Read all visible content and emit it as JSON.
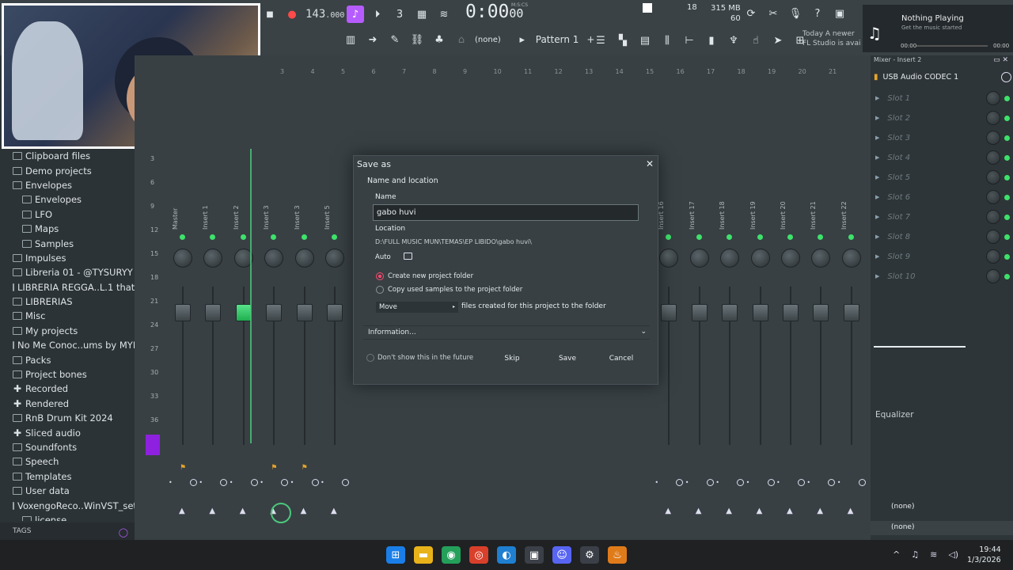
{
  "toolbar": {
    "tempo": "143",
    "tempo_frac": ".000",
    "time": "0:00",
    "time_small": "00",
    "time_label": "M:S:CS",
    "cpu": "18",
    "mem": "315 MB",
    "poly": "60",
    "pattern": "Pattern 1",
    "none_label": "(none)",
    "news_line1": "Today  A newer",
    "news_line2": "FL Studio is avai"
  },
  "media": {
    "title": "Nothing Playing",
    "subtitle": "Get the music started",
    "time_start": "00:00",
    "time_end": "00:00"
  },
  "browser": {
    "items": [
      {
        "label": "Clipboard files",
        "level": 0,
        "icon": "folder-icon"
      },
      {
        "label": "Demo projects",
        "level": 0,
        "icon": "folder-icon"
      },
      {
        "label": "Envelopes",
        "level": 0,
        "icon": "folder-icon"
      },
      {
        "label": "Envelopes",
        "level": 1,
        "icon": "folder-icon"
      },
      {
        "label": "LFO",
        "level": 1,
        "icon": "folder-icon"
      },
      {
        "label": "Maps",
        "level": 1,
        "icon": "folder-icon"
      },
      {
        "label": "Samples",
        "level": 1,
        "icon": "folder-icon"
      },
      {
        "label": "Impulses",
        "level": 0,
        "icon": "folder-icon"
      },
      {
        "label": "Libreria 01 - @TYSURYY",
        "level": 0,
        "icon": "folder-icon"
      },
      {
        "label": "LIBRERIA REGGA..L.1 thatboy r",
        "level": 0,
        "icon": "folder-icon"
      },
      {
        "label": "LIBRERIAS",
        "level": 0,
        "icon": "folder-icon"
      },
      {
        "label": "Misc",
        "level": 0,
        "icon": "folder-icon"
      },
      {
        "label": "My projects",
        "level": 0,
        "icon": "folder-icon"
      },
      {
        "label": "No Me Conoc..ums by MYMBA",
        "level": 0,
        "icon": "folder-icon"
      },
      {
        "label": "Packs",
        "level": 0,
        "icon": "folder-icon"
      },
      {
        "label": "Project bones",
        "level": 0,
        "icon": "folder-icon"
      },
      {
        "label": "Recorded",
        "level": 0,
        "icon": "plus-icon"
      },
      {
        "label": "Rendered",
        "level": 0,
        "icon": "plus-icon"
      },
      {
        "label": "RnB Drum Kit 2024",
        "level": 0,
        "icon": "folder-icon"
      },
      {
        "label": "Sliced audio",
        "level": 0,
        "icon": "plus-icon"
      },
      {
        "label": "Soundfonts",
        "level": 0,
        "icon": "folder-icon"
      },
      {
        "label": "Speech",
        "level": 0,
        "icon": "folder-icon"
      },
      {
        "label": "Templates",
        "level": 0,
        "icon": "folder-icon"
      },
      {
        "label": "User data",
        "level": 0,
        "icon": "folder-icon"
      },
      {
        "label": "VoxengoReco..WinVST_setup",
        "level": 0,
        "icon": "folder-icon"
      },
      {
        "label": "license",
        "level": 1,
        "icon": "file-icon"
      }
    ],
    "tags_label": "TAGS"
  },
  "mixer": {
    "ruler": [
      "3",
      "4",
      "5",
      "6",
      "7",
      "8",
      "9",
      "10",
      "11",
      "12",
      "13",
      "14",
      "15",
      "16",
      "17",
      "18",
      "19",
      "20",
      "21"
    ],
    "db_scale": [
      "3",
      "6",
      "9",
      "12",
      "15",
      "18",
      "21",
      "24",
      "27",
      "30",
      "33",
      "36"
    ],
    "tracks": [
      {
        "name": "Master"
      },
      {
        "name": "Insert 1"
      },
      {
        "name": "Insert 2"
      },
      {
        "name": "Insert 3"
      },
      {
        "name": "Insert 3"
      },
      {
        "name": "Insert 5"
      },
      {
        "name": ""
      },
      {
        "name": ""
      },
      {
        "name": ""
      },
      {
        "name": ""
      },
      {
        "name": ""
      },
      {
        "name": ""
      },
      {
        "name": ""
      },
      {
        "name": ""
      },
      {
        "name": ""
      },
      {
        "name": ""
      },
      {
        "name": "Insert 16"
      },
      {
        "name": "Insert 17"
      },
      {
        "name": "Insert 18"
      },
      {
        "name": "Insert 19"
      },
      {
        "name": "Insert 20"
      },
      {
        "name": "Insert 21"
      },
      {
        "name": "Insert 22"
      }
    ]
  },
  "insert_panel": {
    "title": "Mixer - Insert 2",
    "input": "USB Audio CODEC  1",
    "slots": [
      "Slot 1",
      "Slot 2",
      "Slot 3",
      "Slot 4",
      "Slot 5",
      "Slot 6",
      "Slot 7",
      "Slot 8",
      "Slot 9",
      "Slot 10"
    ],
    "eq_label": "Equalizer",
    "out1": "(none)",
    "out2": "(none)"
  },
  "dialog": {
    "title": "Save as",
    "close": "✕",
    "section": "Name and location",
    "name_label": "Name",
    "name_value": "gabo huvi",
    "location_label": "Location",
    "location_path": "D:\\FULL MUSIC MUN\\TEMAS\\EP LIBIDO\\gabo huvi\\",
    "auto_label": "Auto",
    "radio1": "Create new project folder",
    "radio2": "Copy used samples to the project folder",
    "move_select": "Move",
    "move_text": "files created for this project to the folder",
    "information": "Information...",
    "dont_show": "Don't show this in the future",
    "skip": "Skip",
    "save": "Save",
    "cancel": "Cancel"
  },
  "taskbar": {
    "time": "19:44",
    "date": "1/3/2026"
  }
}
